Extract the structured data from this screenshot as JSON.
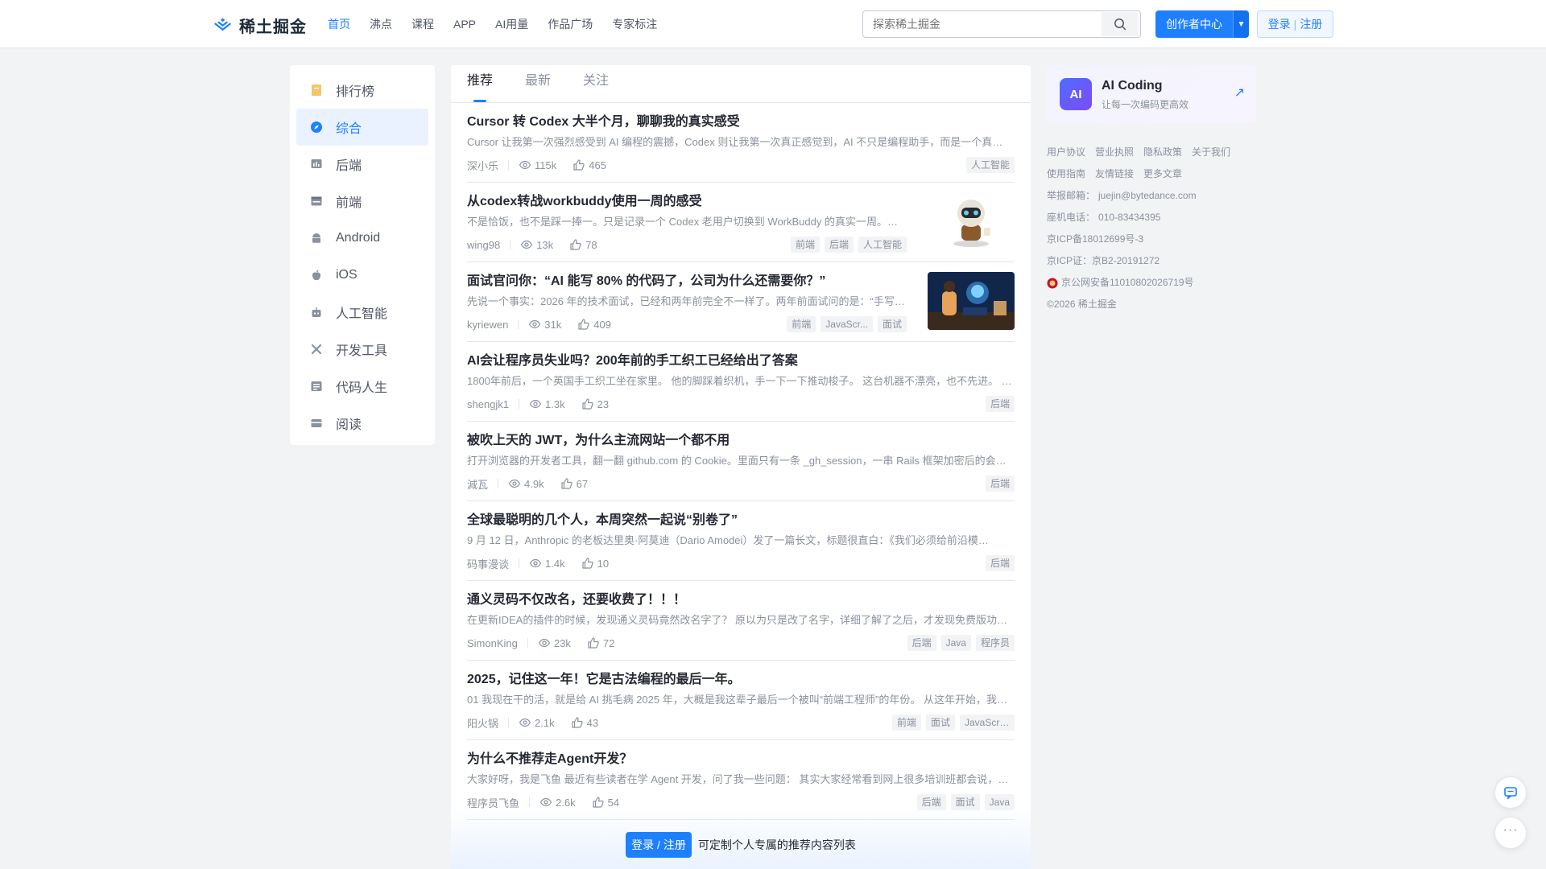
{
  "header": {
    "logo_text": "稀土掘金",
    "nav": [
      "首页",
      "沸点",
      "课程",
      "APP",
      "AI用量",
      "作品广场",
      "专家标注"
    ],
    "search_placeholder": "探索稀土掘金",
    "creator_label": "创作者中心",
    "login_label": "登录",
    "register_label": "注册",
    "login_sep": "|"
  },
  "sidebar": {
    "items": [
      {
        "label": "排行榜",
        "icon": "ranking-icon"
      },
      {
        "label": "综合",
        "icon": "compass-icon"
      },
      {
        "label": "后端",
        "icon": "backend-icon"
      },
      {
        "label": "前端",
        "icon": "frontend-icon"
      },
      {
        "label": "Android",
        "icon": "android-icon"
      },
      {
        "label": "iOS",
        "icon": "apple-icon"
      },
      {
        "label": "人工智能",
        "icon": "robot-icon"
      },
      {
        "label": "开发工具",
        "icon": "tools-icon"
      },
      {
        "label": "代码人生",
        "icon": "code-life-icon"
      },
      {
        "label": "阅读",
        "icon": "reading-icon"
      }
    ]
  },
  "feed": {
    "tabs": [
      "推荐",
      "最新",
      "关注"
    ],
    "articles": [
      {
        "title": "Cursor 转 Codex 大半个月，聊聊我的真实感受",
        "brief": "Cursor 让我第一次强烈感受到 AI 编程的震撼，Codex 则让我第一次真正感觉到，AI 不只是编程助手，而是一个真…",
        "author": "深小乐",
        "views": "115k",
        "likes": "465",
        "tags": [
          "人工智能"
        ]
      },
      {
        "title": "从codex转战workbuddy使用一周的感受",
        "brief": "不是恰饭，也不是踩一捧一。只是记录一个 Codex 老用户切换到 WorkBuddy 的真实一周。…",
        "author": "wing98",
        "views": "13k",
        "likes": "78",
        "tags": [
          "前端",
          "后端",
          "人工智能"
        ]
      },
      {
        "title": "面试官问你：“AI 能写 80% 的代码了，公司为什么还需要你？”",
        "brief": "先说一个事实：2026 年的技术面试，已经和两年前完全不一样了。两年前面试问的是：“手写…",
        "author": "kyriewen",
        "views": "31k",
        "likes": "409",
        "tags": [
          "前端",
          "JavaScr...",
          "面试"
        ]
      },
      {
        "title": "AI会让程序员失业吗？200年前的手工织工已经给出了答案",
        "brief": "1800年前后，一个英国手工织工坐在家里。 他的脚踩着织机，手一下一下推动梭子。 这台机器不漂亮，也不先进。 …",
        "author": "shengjk1",
        "views": "1.3k",
        "likes": "23",
        "tags": [
          "后端"
        ]
      },
      {
        "title": "被吹上天的 JWT，为什么主流网站一个都不用",
        "brief": "打开浏览器的开发者工具，翻一翻 github.com 的 Cookie。里面只有一条 _gh_session，一串 Rails 框架加密后的会…",
        "author": "減瓦",
        "views": "4.9k",
        "likes": "67",
        "tags": [
          "后端"
        ]
      },
      {
        "title": "全球最聪明的几个人，本周突然一起说“别卷了”",
        "brief": "9 月 12 日，Anthropic 的老板达里奥·阿莫迪（Dario Amodei）发了一篇长文，标题很直白：《我们必须给前沿模…",
        "author": "码事漫谈",
        "views": "1.4k",
        "likes": "10",
        "tags": [
          "后端"
        ]
      },
      {
        "title": "通义灵码不仅改名，还要收费了！！！",
        "brief": "在更新IDEA的插件的时候，发现通义灵码竟然改名字了？ 原以为只是改了名字，详细了解了之后，才发现免费版功…",
        "author": "SimonKing",
        "views": "23k",
        "likes": "72",
        "tags": [
          "后端",
          "Java",
          "程序员"
        ]
      },
      {
        "title": "2025，记住这一年！它是古法编程的最后一年。",
        "brief": "01 我现在干的活，就是给 AI 挑毛病 2025 年，大概是我这辈子最后一个被叫“前端工程师”的年份。 从这年开始，我…",
        "author": "阳火锅",
        "views": "2.1k",
        "likes": "43",
        "tags": [
          "前端",
          "面试",
          "JavaScript"
        ]
      },
      {
        "title": "为什么不推荐走Agent开发？",
        "brief": "大家好呀，我是飞鱼 最近有些读者在学 Agent 开发，问了我一些问题： 其实大家经常看到网上很多培训班都会说，…",
        "author": "程序员飞鱼",
        "views": "2.6k",
        "likes": "54",
        "tags": [
          "后端",
          "面试",
          "Java"
        ]
      }
    ],
    "login_bar": {
      "button": "登录 / 注册",
      "text": "可定制个人专属的推荐内容列表"
    }
  },
  "right": {
    "ai_card": {
      "logo": "AI",
      "title": "AI Coding",
      "subtitle": "让每一次编码更高效",
      "arrow": "↗"
    },
    "footer": {
      "links_row1": [
        "用户协议",
        "营业执照",
        "隐私政策",
        "关于我们"
      ],
      "links_row2": [
        "使用指南",
        "友情链接",
        "更多文章"
      ],
      "email_label": "举报邮箱：",
      "email": "juejin@bytedance.com",
      "phone_label": "座机电话：",
      "phone": "010-83434395",
      "icp1": "京ICP备18012699号-3",
      "icp2": "京ICP证：京B2-20191272",
      "police": "京公网安备11010802026719号",
      "copyright": "©2026 稀土掘金"
    }
  },
  "colors": {
    "accent": "#1e80ff",
    "text": "#252933",
    "muted": "#8a919f",
    "bg": "#f2f3f5"
  }
}
